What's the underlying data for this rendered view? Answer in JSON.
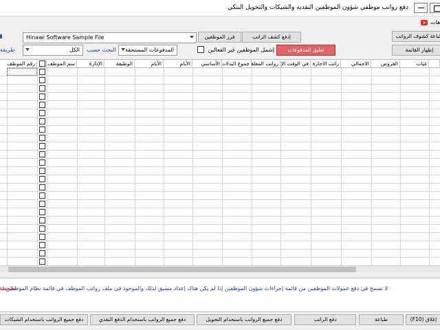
{
  "window": {
    "title": "دفع رواتب موظفي شؤون الموظفين النقدية والشيكات والتحويل البنكي"
  },
  "toolbar": {
    "help_label": "هات",
    "payroll_reports_label": "طباعة كشوف الرواتب",
    "show_list_label": "إظهار القائمة",
    "pay_slip_label": "إدفع كشف الراتب",
    "sort_employees_label": "فرز الموظفين",
    "hold_payments_label": "تعليق المدفوعات",
    "include_inactive_label": "إشمل الموظفين غير الفعالين",
    "file_combo_value": "Hinawi Software Sample File",
    "due_payments_combo_value": "المدفوعات المستحقة",
    "search_by_label": "البحث حسب",
    "all_combo_value": "الكل",
    "method_label": "طريقة"
  },
  "grid": {
    "columns": [
      "رقم الموظف",
      "",
      "سم الموظف",
      "الإدارة",
      "الوظيفة",
      "الأيام",
      "الأيام",
      "الأساسي",
      "جموع البدلات",
      "رواتب المعلقة",
      "في الوقت الإضافي",
      "راتب الاجازة",
      "الاجمالي",
      "القروض",
      "غياب",
      ""
    ]
  },
  "message": {
    "main_text": "لا تسمح في دفع عمولات الموظفين من قائمة إجراءات شؤون الموظفين إذا لم يكن هناك إعداد مسبق لذلك والموجود في ملف رواتب الموظف في قائمة نظام الموظفين",
    "red_text": ":ملاحظة"
  },
  "bottom_bar": {
    "close_label": "(F10) إغلاق",
    "print_label": "طباعة",
    "pay_salary_label": "دفع الراتب",
    "pay_all_transfer_label": "دفع جميع الرواتب باستخدام التحويل",
    "pay_all_cash_label": "دفع جميع الرواتب باستخدام الدفع النقدي",
    "pay_all_cheque_label": "دفع جميع الرواتب باستخدام الشيكات"
  },
  "colors": {
    "hold_button": "#e06666",
    "message_text": "#1a3fbf",
    "note_red": "#dd0000"
  }
}
